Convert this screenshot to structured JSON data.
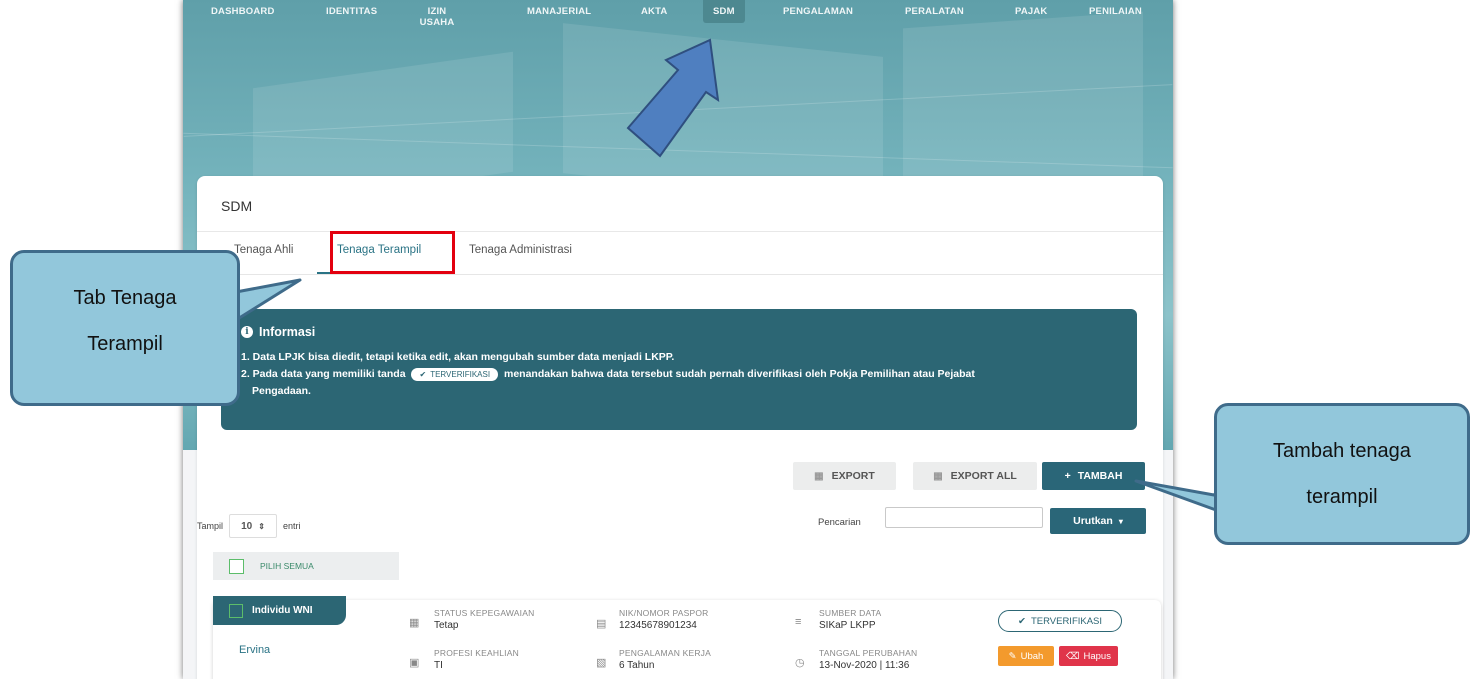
{
  "nav": {
    "items": [
      "DASHBOARD",
      "IDENTITAS",
      "IZIN USAHA",
      "MANAJERIAL",
      "AKTA",
      "SDM",
      "PENGALAMAN",
      "PERALATAN",
      "PAJAK",
      "PENILAIAN"
    ],
    "active": "SDM"
  },
  "card": {
    "title": "SDM",
    "tabs": [
      "Tenaga Ahli",
      "Tenaga Terampil",
      "Tenaga Administrasi"
    ],
    "active_tab": "Tenaga Terampil"
  },
  "info": {
    "title": "Informasi",
    "line1": "1. Data LPJK bisa diedit, tetapi ketika edit, akan mengubah sumber data menjadi LKPP.",
    "line2_pre": "2. Pada data yang memiliki tanda",
    "line2_badge": "TERVERIFIKASI",
    "line2_post": "menandakan bahwa data tersebut sudah pernah diverifikasi oleh Pokja Pemilihan atau Pejabat",
    "line3": "Pengadaan."
  },
  "toolbar": {
    "export": "EXPORT",
    "export_all": "EXPORT ALL",
    "tambah": "TAMBAH"
  },
  "list_controls": {
    "tampil_label": "Tampil",
    "tampil_value": "10",
    "entri_label": "entri",
    "pencarian_label": "Pencarian",
    "search_value": "",
    "urutkan_label": "Urutkan"
  },
  "pilih_semua": "PILIH SEMUA",
  "item": {
    "tag": "Individu WNI",
    "name": "Ervina",
    "status_label": "STATUS KEPEGAWAIAN",
    "status_value": "Tetap",
    "nik_label": "NIK/NOMOR PASPOR",
    "nik_value": "12345678901234",
    "sumber_label": "SUMBER DATA",
    "sumber_value": "SIKaP LKPP",
    "profesi_label": "PROFESI KEAHLIAN",
    "profesi_value": "TI",
    "pengalaman_label": "PENGALAMAN KERJA",
    "pengalaman_value": "6 Tahun",
    "tanggal_label": "TANGGAL PERUBAHAN",
    "tanggal_value": "13-Nov-2020 | 11:36",
    "verif_label": "TERVERIFIKASI",
    "ubah_label": "Ubah",
    "hapus_label": "Hapus"
  },
  "callouts": {
    "tab_line1": "Tab Tenaga",
    "tab_line2": "Terampil",
    "tambah_line1": "Tambah tenaga",
    "tambah_line2": "terampil"
  },
  "colors": {
    "primary": "#2c6674",
    "callout_fill": "#92c7db",
    "callout_border": "#3f6b8a",
    "highlight": "#e3000f",
    "arrow": "#4f7fc0"
  }
}
